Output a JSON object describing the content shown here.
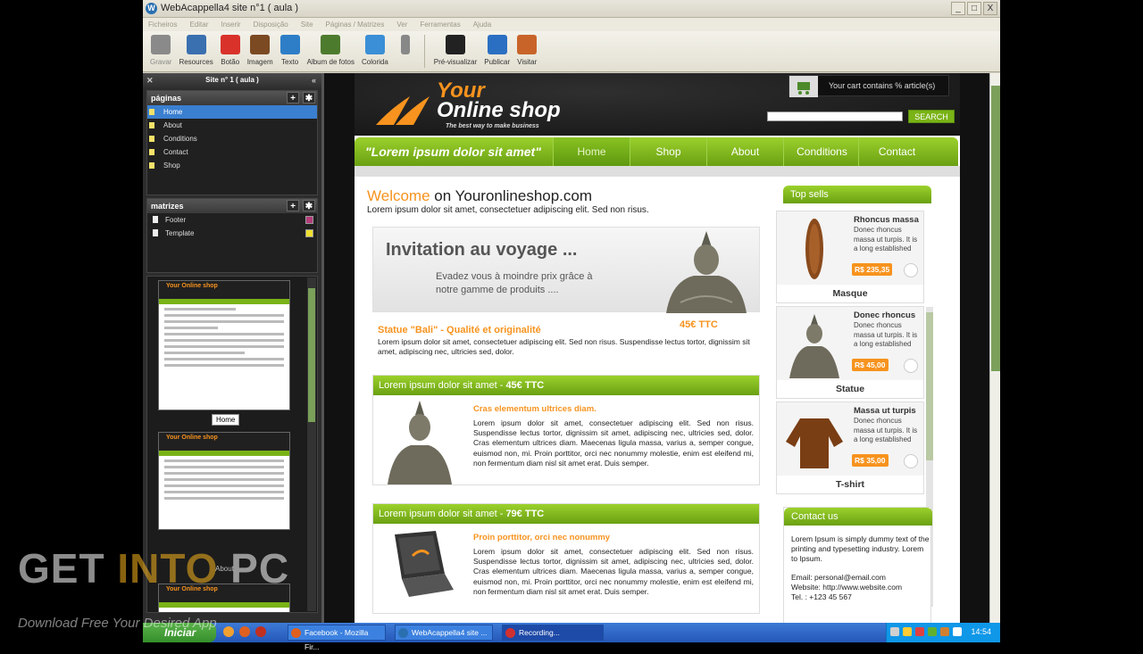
{
  "window": {
    "title": "WebAcappella4 site n°1 ( aula )",
    "controls": [
      "_",
      "□",
      "X"
    ]
  },
  "menu": [
    "Ficheiros",
    "Editar",
    "Inserir",
    "Disposição",
    "Site",
    "Páginas / Matrizes",
    "Ver",
    "Ferramentas",
    "Ajuda"
  ],
  "toolbar": {
    "items": [
      {
        "label": "Gravar",
        "icon": "save-icon",
        "color": "#8a8a8a"
      },
      {
        "label": "Resources",
        "icon": "resources-icon",
        "color": "#3a6fb0"
      },
      {
        "label": "Botão",
        "icon": "button-icon",
        "color": "#d9322b"
      },
      {
        "label": "Imagem",
        "icon": "image-icon",
        "color": "#7b4a22"
      },
      {
        "label": "Texto",
        "icon": "text-icon",
        "color": "#2e7ec7"
      },
      {
        "label": "Album de fotos",
        "icon": "photo-album-icon",
        "color": "#4d7b2e"
      },
      {
        "label": "Colorida",
        "icon": "color-icon",
        "color": "#3a8fd6"
      },
      {
        "label": "",
        "icon": "more-icon",
        "color": "#888888"
      },
      {
        "label": "Pré-visualizar",
        "icon": "preview-icon",
        "color": "#222222"
      },
      {
        "label": "Publicar",
        "icon": "publish-globe-icon",
        "color": "#2b6fc2"
      },
      {
        "label": "Visitar",
        "icon": "home-icon",
        "color": "#c8642a"
      }
    ]
  },
  "left_panel": {
    "title": "Site n° 1 ( aula )",
    "pages_header": "páginas",
    "pages": [
      {
        "label": "Home",
        "selected": true
      },
      {
        "label": "About",
        "selected": false
      },
      {
        "label": "Conditions",
        "selected": false
      },
      {
        "label": "Contact",
        "selected": false
      },
      {
        "label": "Shop",
        "selected": false
      }
    ],
    "templates_header": "matrizes",
    "templates": [
      {
        "label": "Footer",
        "check_color": "#b43c7a"
      },
      {
        "label": "Template",
        "check_color": "#f0e030"
      }
    ],
    "thumbnails": [
      {
        "label": "Home"
      },
      {
        "label": ""
      },
      {
        "label": "About"
      }
    ]
  },
  "site": {
    "cart_text": "Your cart contains % article(s)",
    "logo_your": "Your",
    "logo_shop": "Online shop",
    "logo_tagline": "The best way to make business",
    "search_button": "SEARCH",
    "search_placeholder": "",
    "nav_slogan": "\"Lorem ipsum dolor sit amet\"",
    "nav": [
      "Home",
      "Shop",
      "About",
      "Conditions",
      "Contact"
    ],
    "welcome_a": "Welcome",
    "welcome_b": " on Youronlineshop.com",
    "intro": "Lorem ipsum dolor sit amet, consectetuer adipiscing elit. Sed non risus.",
    "promo_title": "Invitation au voyage ...",
    "promo_sub": "Evadez vous à moindre prix grâce à notre gamme de produits ....",
    "statue_line": "Statue \"Bali\" - Qualité et originalité",
    "statue_price": "45€ TTC",
    "statue_desc": "Lorem ipsum dolor sit amet, consectetuer adipiscing elit. Sed non risus. Suspendisse lectus tortor, dignissim sit amet, adipiscing nec, ultricies sed, dolor.",
    "products": [
      {
        "head_a": "Lorem ipsum dolor sit amet - ",
        "head_b": "45€ TTC",
        "title": "Cras elementum ultrices diam.",
        "text": "Lorem ipsum dolor sit amet, consectetuer adipiscing elit. Sed non risus. Suspendisse lectus tortor, dignissim sit amet, adipiscing nec, ultricies sed, dolor. Cras elementum ultrices diam. Maecenas ligula massa, varius a, semper congue, euismod non, mi. Proin porttitor, orci nec nonummy molestie, enim est eleifend mi, non fermentum diam nisl sit amet erat. Duis semper."
      },
      {
        "head_a": "Lorem ipsum dolor sit amet - ",
        "head_b": "79€ TTC",
        "title": "Proin porttitor, orci nec nonummy",
        "text": "Lorem ipsum dolor sit amet, consectetuer adipiscing elit. Sed non risus. Suspendisse lectus tortor, dignissim sit amet, adipiscing nec, ultricies sed, dolor. Cras elementum ultrices diam. Maecenas ligula massa, varius a, semper congue, euismod non, mi. Proin porttitor, orci nec nonummy molestie, enim est eleifend mi, non fermentum diam nisl sit amet erat. Duis semper."
      }
    ],
    "top_sells_header": "Top sells",
    "top_sells": [
      {
        "name": "Rhoncus massa",
        "desc": "Donec rhoncus massa ut turpis. It is a long established",
        "price": "R$ 235,35",
        "caption": "Masque"
      },
      {
        "name": "Donec rhoncus",
        "desc": "Donec rhoncus massa ut turpis. It is a long established",
        "price": "R$ 45,00",
        "caption": "Statue"
      },
      {
        "name": "Massa ut turpis",
        "desc": "Donec rhoncus massa ut turpis. It is a long established",
        "price": "R$ 35,00",
        "caption": "T-shirt"
      }
    ],
    "contact_header": "Contact us",
    "contact_text": "Lorem Ipsum is simply dummy text of the printing and typesetting industry. Lorem to Ipsum.",
    "contact_email": "Email: personal@email.com",
    "contact_website": "Website: http://www.website.com",
    "contact_tel": "Tel. : +123 45 567"
  },
  "taskbar": {
    "start": "Iniciar",
    "tasks": [
      "Facebook - Mozilla Fir...",
      "WebAcappella4 site ...",
      "Recording..."
    ],
    "clock": "14:54"
  },
  "watermark": {
    "a": "GET ",
    "b": "INTO",
    "c": " PC",
    "sub": "Download Free Your Desired App"
  }
}
